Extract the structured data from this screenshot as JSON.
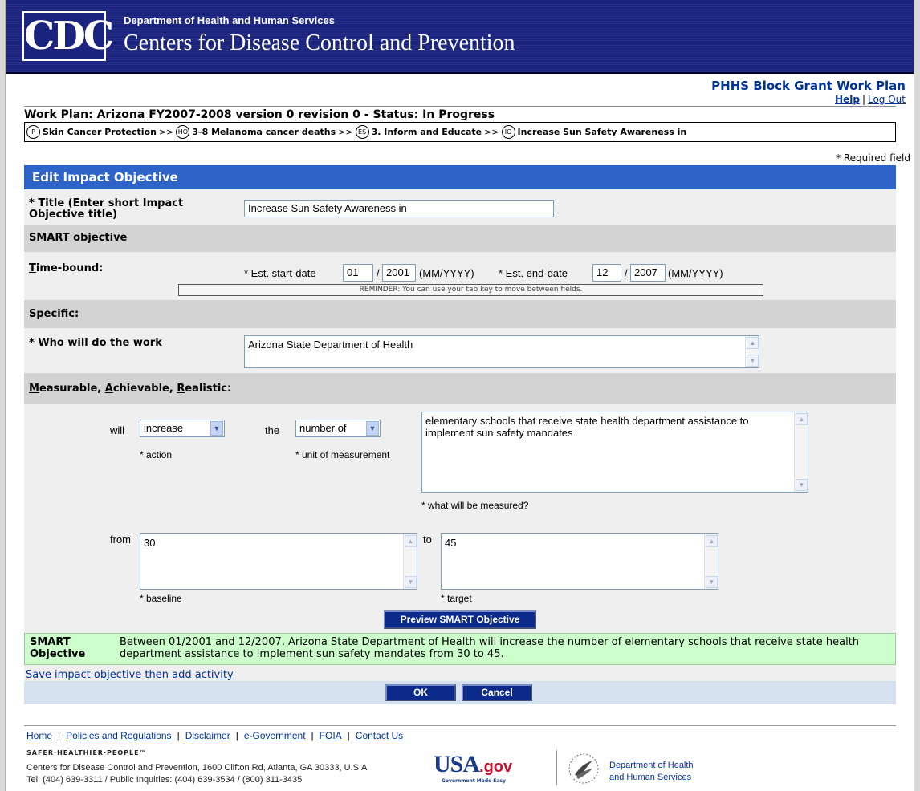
{
  "header": {
    "logo_text": "CDC",
    "dept": "Department of Health and Human Services",
    "agency": "Centers for Disease Control and Prevention"
  },
  "app": {
    "title": "PHHS Block Grant Work Plan",
    "help": "Help",
    "separator": "|",
    "logout": "Log Out"
  },
  "workplan": {
    "title": "Work Plan: Arizona FY2007-2008 version 0 revision 0 - Status: In Progress"
  },
  "breadcrumb": [
    {
      "badge": "P",
      "label": "Skin Cancer Protection"
    },
    {
      "badge": "HO",
      "label": "3-8 Melanoma cancer deaths"
    },
    {
      "badge": "ES",
      "label": "3. Inform and Educate"
    },
    {
      "badge": "IO",
      "label": "Increase Sun Safety Awareness in"
    }
  ],
  "breadcrumb_sep": ">>",
  "required_note": "* Required field",
  "form": {
    "header": "Edit Impact Objective",
    "title_label": "* Title (Enter short Impact Objective title)",
    "title_value": "Increase Sun Safety Awareness in",
    "smart_section": "SMART objective",
    "time_bound_label_u": "T",
    "time_bound_label_rest": "ime-bound:",
    "start_label": "* Est. start-date",
    "start_month": "01",
    "slash": "/",
    "start_year": "2001",
    "date_format": "(MM/YYYY)",
    "end_label": "* Est. end-date",
    "end_month": "12",
    "end_year": "2007",
    "reminder": "REMINDER: You can use your tab key to move between fields.",
    "specific_u": "S",
    "specific_rest": "pecific:",
    "who_label": "* Who will do the work",
    "who_value": "Arizona State Department of Health",
    "mar_m": "M",
    "mar_1": "easurable, ",
    "mar_a": "A",
    "mar_2": "chievable, ",
    "mar_r": "R",
    "mar_3": "ealistic:",
    "will": "will",
    "action_value": "increase",
    "action_label": "* action",
    "the": "the",
    "unit_value": "number of",
    "unit_label": "* unit of measurement",
    "measured_value": "elementary schools that receive state health department assistance to implement sun safety mandates",
    "measured_label": "* what will be measured?",
    "from": "from",
    "baseline_value": "30",
    "baseline_label": "* baseline",
    "to": "to",
    "target_value": "45",
    "target_label": "* target",
    "preview_button": "Preview SMART Objective",
    "smart_label": "SMART Objective",
    "smart_text": "Between 01/2001 and 12/2007, Arizona State Department of Health will increase the number of elementary schools that receive state health department assistance to implement sun safety mandates from 30 to 45.",
    "save_link": "Save impact objective then add activity",
    "ok_button": "OK",
    "cancel_button": "Cancel"
  },
  "footer": {
    "links": [
      "Home",
      "Policies and Regulations",
      "Disclaimer",
      "e-Government",
      "FOIA",
      "Contact Us"
    ],
    "link_sep": "|",
    "tagline": "SAFER·HEALTHIER·PEOPLE™",
    "address": "Centers for Disease Control and Prevention, 1600 Clifton Rd, Atlanta, GA 30333, U.S.A",
    "phones": "Tel: (404) 639-3311 / Public Inquiries: (404) 639-3534 / (800) 311-3435",
    "usagov_usa": "USA",
    "usagov_gov": ".gov",
    "usagov_tag": "Government Made Easy",
    "hhs_link": "Department of Health and Human Services"
  },
  "colors": {
    "banner": "#1a237e",
    "section_header": "#2e64c8",
    "button": "#0b2a8a",
    "smart_box": "#ccffcc",
    "link": "#003399"
  },
  "icons": [
    "cdc-logo",
    "chevron-down-icon",
    "scroll-up-icon",
    "scroll-down-icon",
    "usagov-logo",
    "hhs-eagle-icon"
  ]
}
